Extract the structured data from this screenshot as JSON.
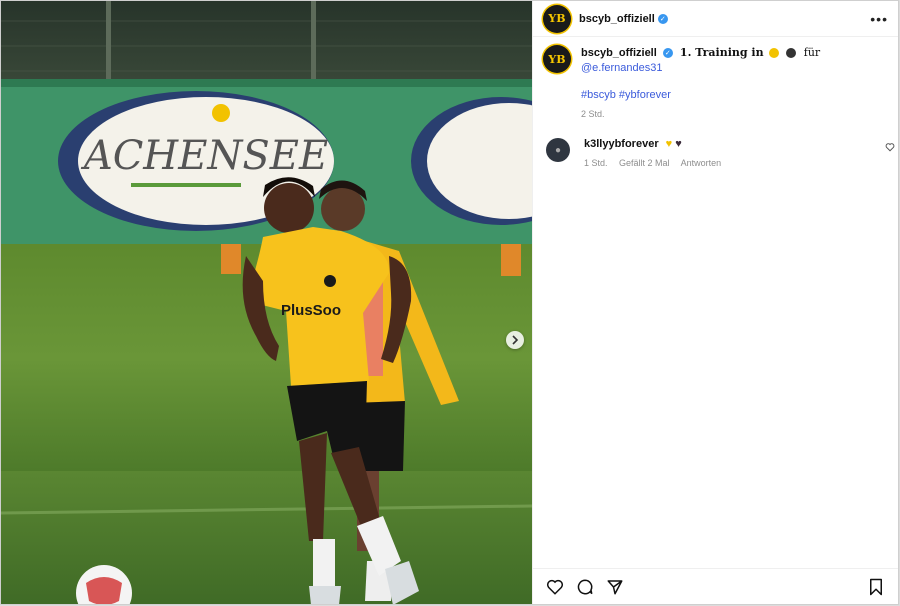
{
  "post": {
    "author": "bscyb_offiziell",
    "avatar_text": "YB",
    "more_icon": "more-horizontal-icon",
    "caption": {
      "title": "1. Training in",
      "word_for": "für",
      "mention": "@e.fernandes31",
      "hashtags": "#bscyb #ybforever",
      "time": "2 Std."
    },
    "photo": {
      "banner_text": "ACHENSEE",
      "jersey_sponsor": "PlusSoo"
    },
    "comments": [
      {
        "user": "k3llyybforever",
        "time": "1 Std.",
        "likes": "Gefällt 2 Mal",
        "reply": "Antworten"
      }
    ]
  },
  "colors": {
    "accent": "#3b5bdb",
    "verified": "#3897f0",
    "yb_yellow": "#f2c200"
  }
}
